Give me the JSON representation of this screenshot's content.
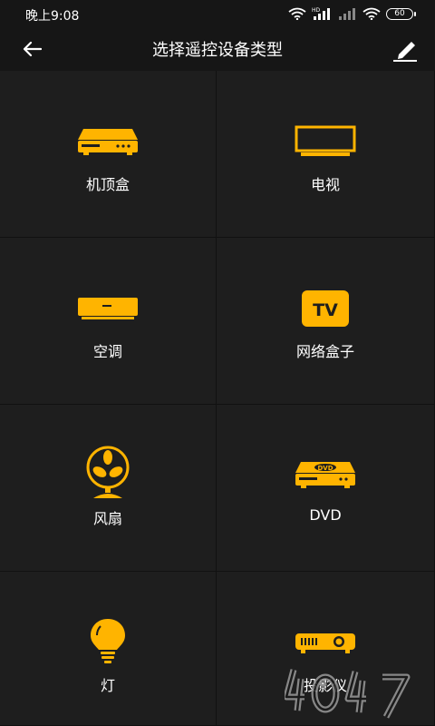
{
  "status_bar": {
    "time": "晚上9:08",
    "battery": "60",
    "net_label": "HD"
  },
  "header": {
    "title": "选择遥控设备类型",
    "back_icon": "arrow-left-icon",
    "edit_icon": "pencil-icon"
  },
  "devices": [
    {
      "label": "机顶盒",
      "icon": "set-top-box-icon"
    },
    {
      "label": "电视",
      "icon": "tv-icon"
    },
    {
      "label": "空调",
      "icon": "air-conditioner-icon"
    },
    {
      "label": "网络盒子",
      "icon": "network-box-icon",
      "badge": "TV"
    },
    {
      "label": "风扇",
      "icon": "fan-icon"
    },
    {
      "label": "DVD",
      "icon": "dvd-icon",
      "badge": "DVD"
    },
    {
      "label": "灯",
      "icon": "bulb-icon"
    },
    {
      "label": "投影仪",
      "icon": "projector-icon"
    }
  ],
  "colors": {
    "accent": "#FFB400",
    "background": "#161616",
    "tile": "#1E1E1E"
  }
}
